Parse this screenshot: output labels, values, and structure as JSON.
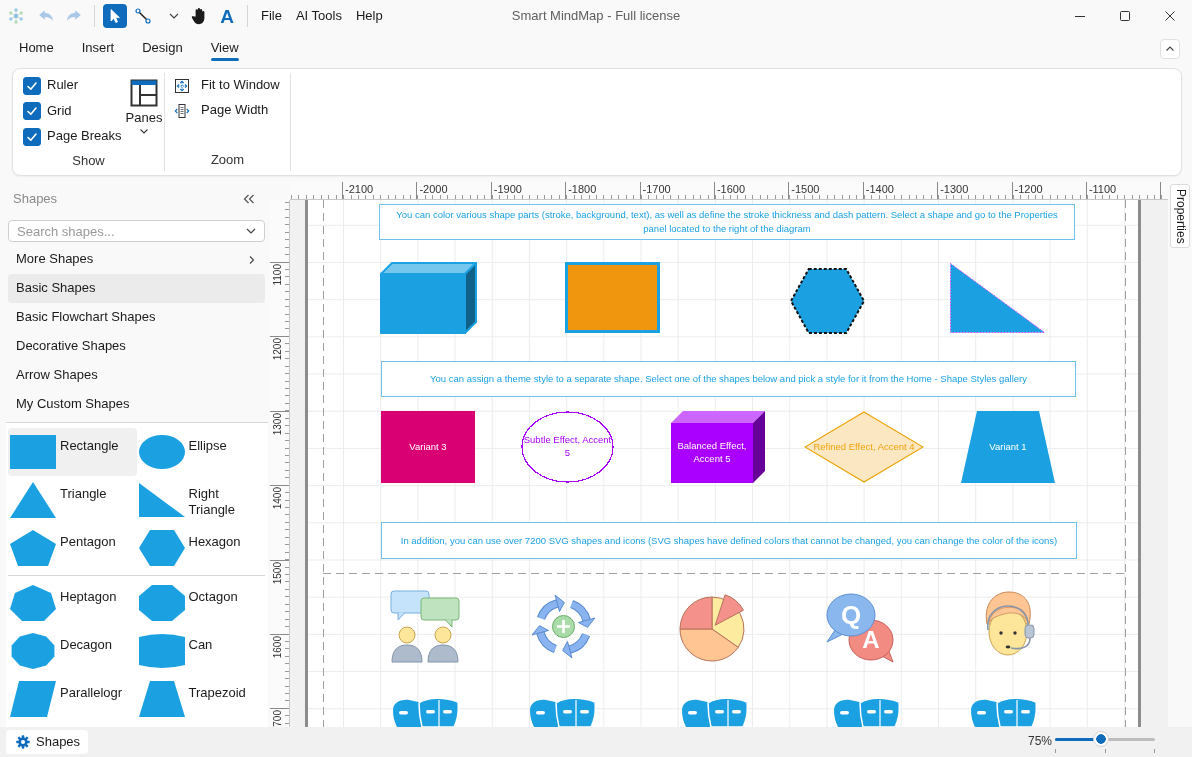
{
  "window": {
    "title": "Smart MindMap - Full license"
  },
  "toolbar": {
    "history": [
      {
        "kind": "undo",
        "disabled": true
      },
      {
        "kind": "redo",
        "disabled": true
      }
    ],
    "tools": [
      {
        "kind": "pointer",
        "selected": true
      },
      {
        "kind": "connector",
        "selected": false
      },
      {
        "kind": "pan",
        "selected": false
      },
      {
        "kind": "text",
        "label": "A",
        "selected": false
      }
    ],
    "menu": [
      "File",
      "AI Tools",
      "Help"
    ]
  },
  "ribbon_tabs": [
    {
      "label": "Home",
      "selected": false
    },
    {
      "label": "Insert",
      "selected": false
    },
    {
      "label": "Design",
      "selected": false
    },
    {
      "label": "View",
      "selected": true
    }
  ],
  "ribbon": {
    "show": {
      "label": "Show",
      "checkboxes": [
        {
          "label": "Ruler",
          "checked": true
        },
        {
          "label": "Grid",
          "checked": true
        },
        {
          "label": "Page Breaks",
          "checked": true
        }
      ],
      "panes": {
        "label": "Panes"
      }
    },
    "zoom": {
      "label": "Zoom",
      "buttons": [
        "Fit to Window",
        "Page Width"
      ]
    }
  },
  "sidebar": {
    "title": "Shapes",
    "search": {
      "placeholder": "Search shapes..."
    },
    "categories": [
      {
        "kind": "submenu",
        "label": "More Shapes",
        "selected": false
      },
      {
        "kind": "category",
        "label": "Basic Shapes",
        "selected": true
      },
      {
        "kind": "category",
        "label": "Basic Flowchart Shapes",
        "selected": false
      },
      {
        "kind": "category",
        "label": "Decorative Shapes",
        "selected": false
      },
      {
        "kind": "category",
        "label": "Arrow Shapes",
        "selected": false
      },
      {
        "kind": "category",
        "label": "My Custom Shapes",
        "selected": false
      }
    ],
    "gallery": [
      {
        "items": [
          {
            "kind": "rectangle",
            "label": "Rectangle",
            "selected": true
          },
          {
            "kind": "ellipse",
            "label": "Ellipse",
            "selected": false
          },
          {
            "kind": "triangle",
            "label": "Triangle",
            "selected": false
          },
          {
            "kind": "right_triangle",
            "label": "Right Triangle",
            "selected": false
          },
          {
            "kind": "pentagon",
            "label": "Pentagon",
            "selected": false
          },
          {
            "kind": "hexagon",
            "label": "Hexagon",
            "selected": false
          }
        ]
      },
      {
        "items": [
          {
            "kind": "heptagon",
            "label": "Heptagon",
            "selected": false
          },
          {
            "kind": "octagon",
            "label": "Octagon",
            "selected": false
          },
          {
            "kind": "decagon",
            "label": "Decagon",
            "selected": false
          },
          {
            "kind": "can",
            "label": "Can",
            "selected": false
          },
          {
            "kind": "parallelogram",
            "label": "Parallelogr",
            "selected": false
          },
          {
            "kind": "trapezoid",
            "label": "Trapezoid",
            "selected": false
          }
        ]
      }
    ]
  },
  "canvas": {
    "horizontal_ruler": [
      "-2100",
      "-2000",
      "-1900",
      "-1800",
      "-1700",
      "-1600",
      "-1500",
      "-1400",
      "-1300",
      "-1200",
      "-1100"
    ],
    "vertical_ruler": [
      "1100",
      "1200",
      "1300",
      "1400",
      "1500",
      "1600",
      "700"
    ],
    "sections": [
      {
        "note": "You can color various shape parts (stroke, background, text), as well as define the stroke thickness and dash pattern. Select a shape and go to the Properties panel located to the right of the diagram",
        "shapes": [
          {
            "kind": "outlined_cube",
            "color": "#1ba1e2"
          },
          {
            "kind": "outlined_rectangle",
            "color": "#f0960e"
          },
          {
            "kind": "dashed_hexagon",
            "color": "#1ba1e2"
          },
          {
            "kind": "dotted_triangle",
            "color": "#1ba1e2"
          }
        ]
      },
      {
        "note": "You can assign a theme style to a separate shape. Select one of the shapes below and pick a style for it from the Home - Shape Styles gallery",
        "shapes": [
          {
            "kind": "rectangle",
            "label": "Variant 3",
            "color": "#d80073"
          },
          {
            "kind": "outline_ellipse",
            "label": "Subtle Effect, Accent 5",
            "color": "#aa00ff"
          },
          {
            "kind": "cube",
            "label": "Balanced Effect, Accent 5",
            "color": "#aa00ff"
          },
          {
            "kind": "diamond",
            "label": "Refined Effect, Accent 4",
            "color": "#fbe8c2"
          },
          {
            "kind": "trapezoid",
            "label": "Variant 1",
            "color": "#1ba1e2"
          }
        ]
      },
      {
        "note": "In addition, you can use over 7200 SVG shapes and icons (SVG shapes have defined colors that cannot be changed, you can change the color of the icons)",
        "icon_letters": [
          "Q",
          "A"
        ]
      }
    ]
  },
  "properties_tab": {
    "label": "Properties"
  },
  "status_bar": {
    "panel_tab": {
      "label": "Shapes"
    },
    "zoom": {
      "reading": "75%",
      "level": 0.45
    }
  }
}
